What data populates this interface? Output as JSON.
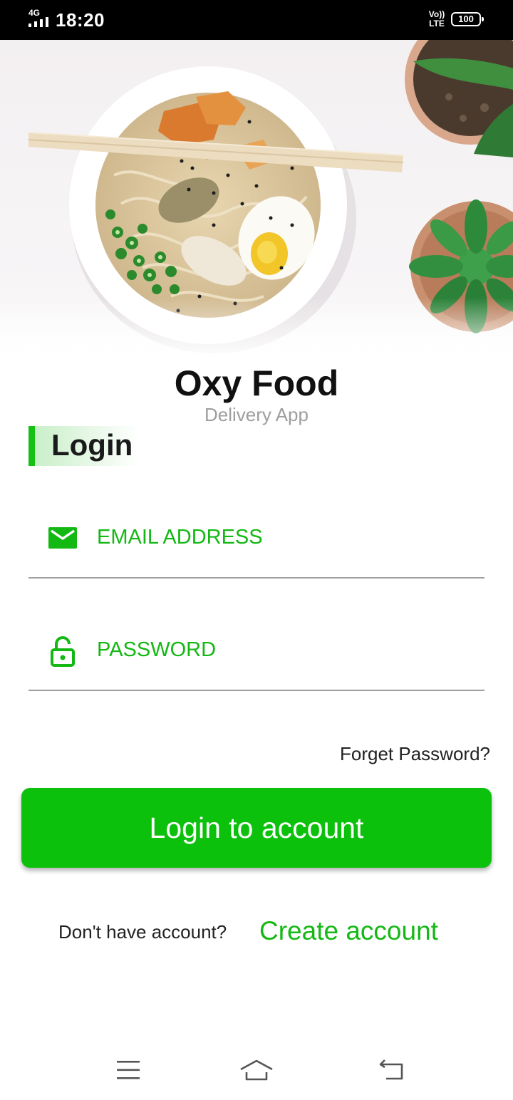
{
  "status_bar": {
    "network": "4G",
    "time": "18:20",
    "volte": "Vo))",
    "volte_sub": "LTE",
    "battery": "100"
  },
  "hero": {
    "image": "ramen-bowl-with-succulents"
  },
  "brand": {
    "name": "Oxy Food",
    "tagline": "Delivery App"
  },
  "login": {
    "heading": "Login",
    "email_placeholder": "EMAIL ADDRESS",
    "email_value": "",
    "email_icon": "mail-icon",
    "password_placeholder": "PASSWORD",
    "password_value": "",
    "password_icon": "lock-open-icon",
    "forgot_label": "Forget Password?",
    "submit_label": "Login to account",
    "signup_prompt": "Don't have account?",
    "signup_link": "Create account"
  },
  "nav_bar": {
    "menu_icon": "menu-icon",
    "home_icon": "home-icon",
    "back_icon": "back-icon"
  },
  "colors": {
    "accent": "#0bc10b",
    "accent_text": "#13b813",
    "heading_bar": "#14c114",
    "muted_text": "#9e9e9e",
    "divider": "#9e9e9e"
  }
}
